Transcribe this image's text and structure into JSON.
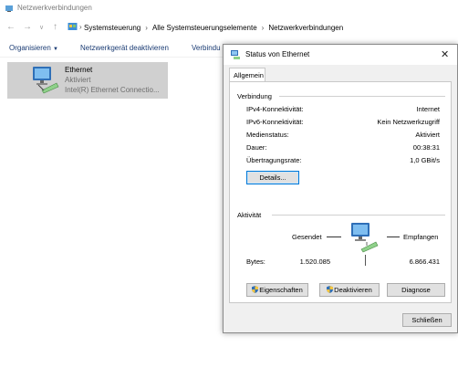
{
  "window": {
    "title": "Netzwerkverbindungen"
  },
  "address": {
    "crumbs": [
      "Systemsteuerung",
      "Alle Systemsteuerungselemente",
      "Netzwerkverbindungen"
    ]
  },
  "toolbar": {
    "organize": "Organisieren",
    "disable_device": "Netzwerkgerät deaktivieren",
    "truncated": "Verbindu"
  },
  "adapter": {
    "name": "Ethernet",
    "status": "Aktiviert",
    "device": "Intel(R) Ethernet Connectio..."
  },
  "dialog": {
    "title": "Status von Ethernet",
    "tab": "Allgemein",
    "connection": {
      "heading": "Verbindung",
      "rows": [
        {
          "label": "IPv4-Konnektivität:",
          "value": "Internet"
        },
        {
          "label": "IPv6-Konnektivität:",
          "value": "Kein Netzwerkzugriff"
        },
        {
          "label": "Medienstatus:",
          "value": "Aktiviert"
        },
        {
          "label": "Dauer:",
          "value": "00:38:31"
        },
        {
          "label": "Übertragungsrate:",
          "value": "1,0 GBit/s"
        }
      ],
      "details_button": "Details..."
    },
    "activity": {
      "heading": "Aktivität",
      "sent_label": "Gesendet",
      "received_label": "Empfangen",
      "bytes_label": "Bytes:",
      "bytes_sent": "1.520.085",
      "bytes_received": "6.866.431"
    },
    "buttons": {
      "properties": "Eigenschaften",
      "deactivate": "Deaktivieren",
      "diagnose": "Diagnose",
      "close": "Schließen"
    }
  }
}
